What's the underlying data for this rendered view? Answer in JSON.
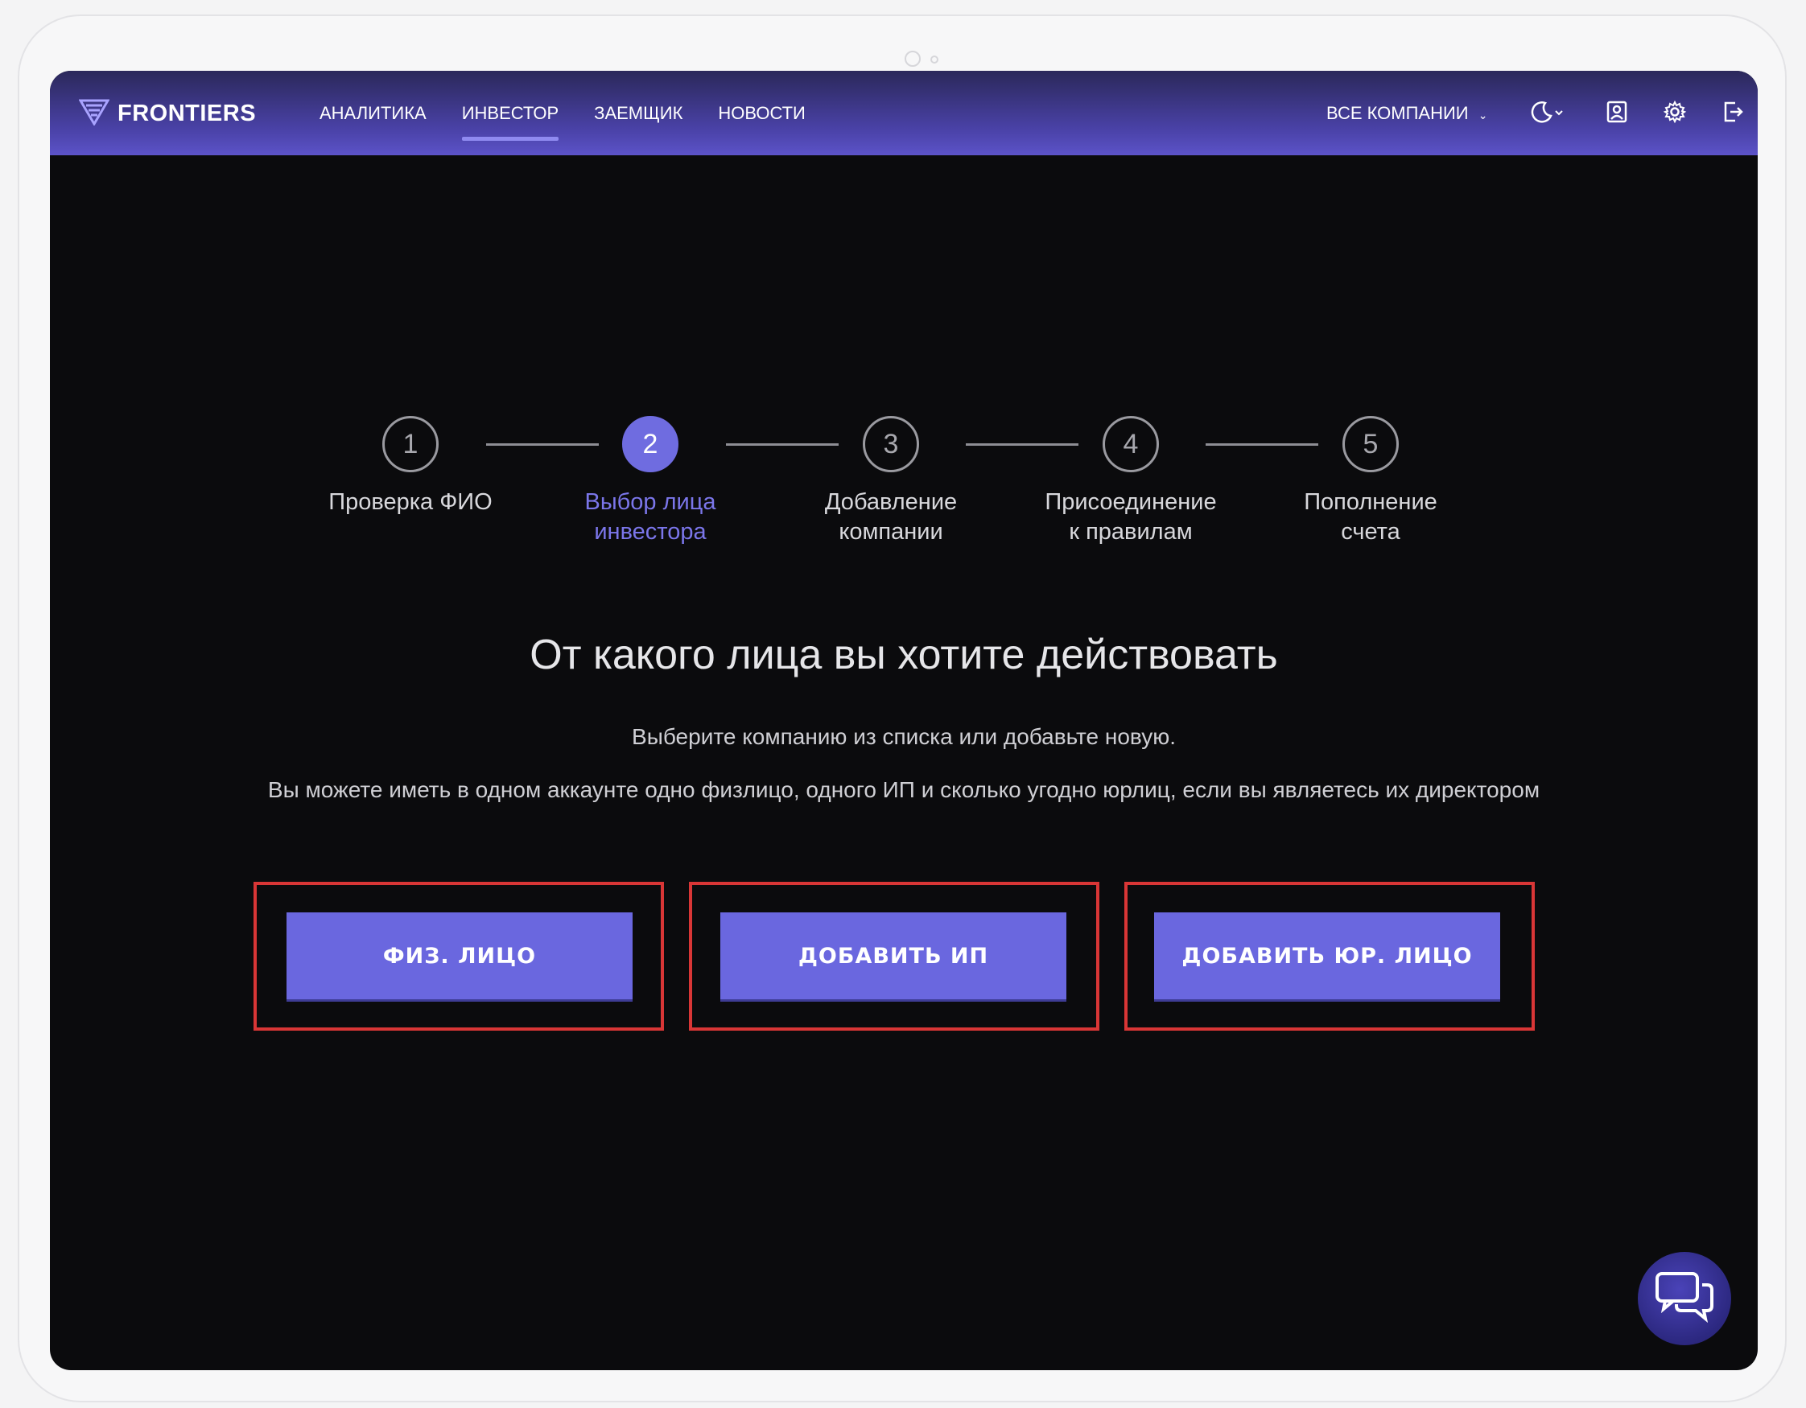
{
  "app": {
    "name": "FRONTIERS"
  },
  "nav": [
    {
      "label": "АНАЛИТИКА",
      "active": false
    },
    {
      "label": "ИНВЕСТОР",
      "active": true
    },
    {
      "label": "ЗАЕМЩИК",
      "active": false
    },
    {
      "label": "НОВОСТИ",
      "active": false
    }
  ],
  "header": {
    "companies_label": "ВСЕ КОМПАНИИ"
  },
  "icons": [
    "moon-icon",
    "user-card-icon",
    "gear-icon",
    "logout-icon",
    "chat-icon"
  ],
  "stepper": [
    {
      "number": "1",
      "line1": "Проверка ФИО",
      "line2": "",
      "active": false
    },
    {
      "number": "2",
      "line1": "Выбор лица",
      "line2": "инвестора",
      "active": true
    },
    {
      "number": "3",
      "line1": "Добавление",
      "line2": "компании",
      "active": false
    },
    {
      "number": "4",
      "line1": "Присоединение",
      "line2": "к правилам",
      "active": false
    },
    {
      "number": "5",
      "line1": "Пополнение",
      "line2": "счета",
      "active": false
    }
  ],
  "main": {
    "title": "От какого лица вы хотите действовать",
    "subtitle": "Выберите компанию из списка или добавьте новую.",
    "note": "Вы можете иметь в одном аккаунте одно физлицо, одного ИП и сколько угодно юрлиц, если вы являетесь их директором"
  },
  "choices": {
    "individual": "ФИЗ. ЛИЦО",
    "add_ip": "ДОБАВИТЬ ИП",
    "add_legal": "ДОБАВИТЬ ЮР. ЛИЦО"
  },
  "colors": {
    "accent": "#6a67df",
    "header_gradient_end": "#5c53c8",
    "background": "#0b0b0d",
    "highlight_frame": "#d93636"
  }
}
